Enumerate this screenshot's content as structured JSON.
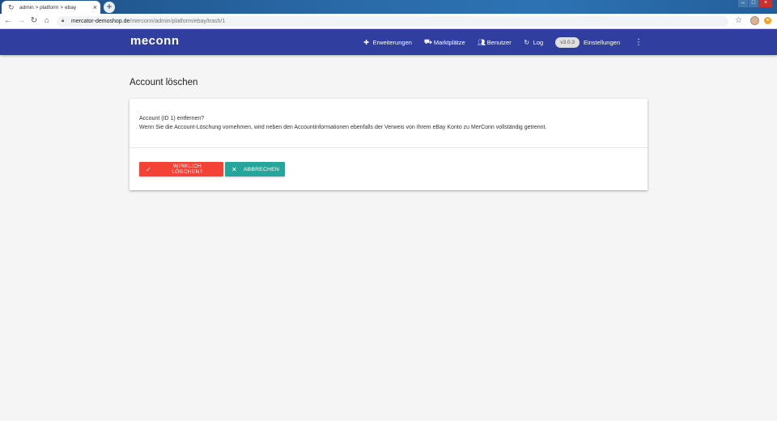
{
  "browser": {
    "tab_title": "admin > platform > ebay",
    "url_host": "mercator-demoshop.de",
    "url_path": "/merconn/admin/platform/ebay/trash/1"
  },
  "app": {
    "logo": "meconn",
    "nav": [
      {
        "label": "Erweiterungen",
        "icon": "puzzle-icon"
      },
      {
        "label": "Marktplätze",
        "icon": "cart-icon"
      },
      {
        "label": "Benutzer",
        "icon": "people-icon"
      },
      {
        "label": "Log",
        "icon": "refresh-icon"
      }
    ],
    "version": "v3.0.3",
    "settings": "Einstellungen"
  },
  "page": {
    "title": "Account löschen",
    "question": "Account (ID 1) entfernen?",
    "message": "Wenn Sie die Account-Löschung vornehmen, wird neben den Accountinformationen ebenfalls der Verweis von Ihrem eBay Konto zu MerConn vollständig getrennt.",
    "delete_label": "WIRKLICH LÖSCHEN?",
    "cancel_label": "ABBRECHEN"
  },
  "colors": {
    "appbar": "#303f9f",
    "delete": "#f44336",
    "cancel": "#26a69a"
  }
}
